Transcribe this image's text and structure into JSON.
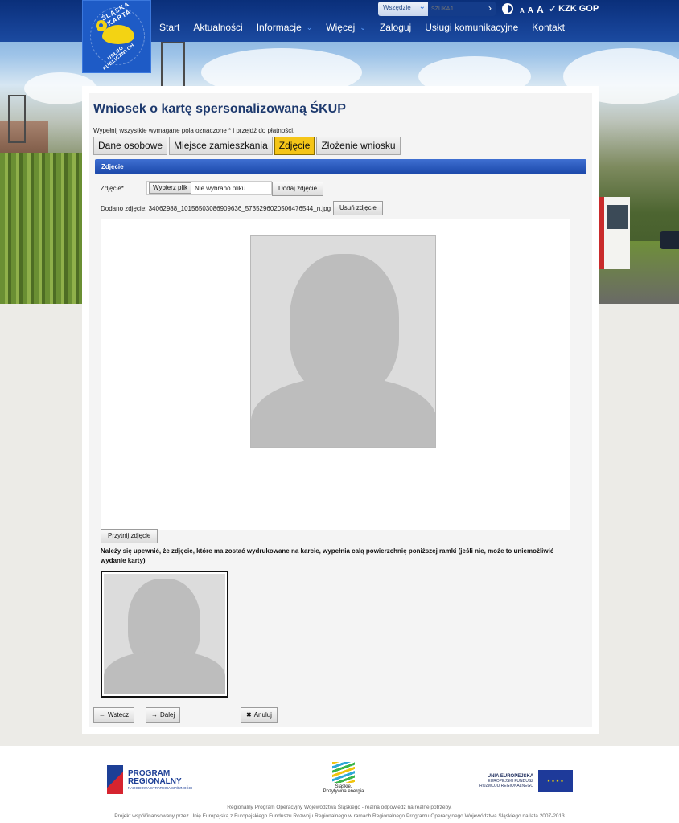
{
  "header": {
    "logo_text_top": "ŚLĄSKA KARTA",
    "logo_text_bottom": "USŁUG PUBLICZNYCH",
    "nav": [
      {
        "label": "Start"
      },
      {
        "label": "Aktualności"
      },
      {
        "label": "Informacje",
        "has_dropdown": true
      },
      {
        "label": "Więcej",
        "has_dropdown": true
      },
      {
        "label": "Zaloguj"
      },
      {
        "label": "Usługi komunikacyjne"
      },
      {
        "label": "Kontakt"
      }
    ],
    "search": {
      "scope": "Wszędzie",
      "placeholder": "SZUKAJ"
    },
    "font_sizes": [
      "A",
      "A",
      "A"
    ],
    "partner": "KZK GOP"
  },
  "form": {
    "title": "Wniosek o kartę spersonalizowaną ŚKUP",
    "hint": "Wypełnij wszystkie wymagane pola oznaczone * i przejdź do płatności.",
    "tabs": [
      {
        "label": "Dane osobowe",
        "active": false
      },
      {
        "label": "Miejsce zamieszkania",
        "active": false
      },
      {
        "label": "Zdjęcie",
        "active": true
      },
      {
        "label": "Złożenie wniosku",
        "active": false
      }
    ],
    "section_title": "Zdjęcie",
    "photo_label": "Zdjęcie*",
    "choose_file": "Wybierz plik",
    "no_file": "Nie wybrano pliku",
    "add_photo": "Dodaj zdjęcie",
    "added_photo": "Dodano zdjęcie: 34062988_10156503086909636_5735296020506476544_n.jpg",
    "remove_photo": "Usuń zdjęcie",
    "crop_photo": "Przytnij zdjęcie",
    "warning": "Należy się upewnić, że zdjęcie, które ma zostać wydrukowane na karcie, wypełnia całą powierzchnię poniższej ramki (jeśli nie, może to uniemożliwić wydanie karty)",
    "back": "Wstecz",
    "next": "Dalej",
    "cancel": "Anuluj"
  },
  "footer": {
    "program_title": "PROGRAM",
    "program_title2": "REGIONALNY",
    "program_sub": "NARODOWA STRATEGIA SPÓJNOŚCI",
    "slaskie": "Śląskie.",
    "slaskie_sub": "Pozytywna energia",
    "eu_line1": "UNIA EUROPEJSKA",
    "eu_line2": "EUROPEJSKI FUNDUSZ",
    "eu_line3": "ROZWOJU REGIONALNEGO",
    "line1": "Regionalny Program Operacyjny Województwa Śląskiego - realna odpowiedź na realne potrzeby.",
    "line2": "Projekt współfinansowany przez Unię Europejską z Europejskiego Funduszu Rozwoju Regionalnego w ramach Regionalnego Programu Operacyjnego Województwa Śląskiego na lata 2007-2013"
  },
  "colors": {
    "accent": "#1e5bc6",
    "active_tab": "#f5c518",
    "header": "#0a2f7a"
  }
}
